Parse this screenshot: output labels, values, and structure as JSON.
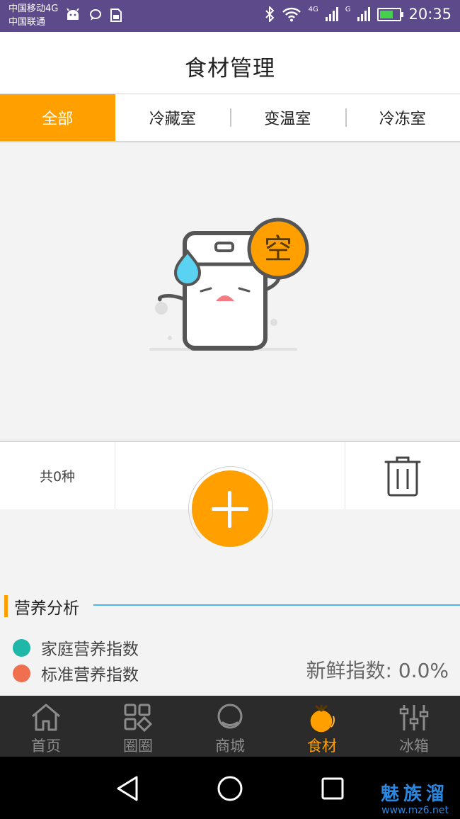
{
  "status_bar": {
    "carrier_1": "中国移动4G",
    "carrier_2": "中国联通",
    "net_1": "4G",
    "net_2": "G",
    "time": "20:35"
  },
  "header": {
    "title": "食材管理"
  },
  "tabs": [
    {
      "label": "全部",
      "active": true
    },
    {
      "label": "冷藏室",
      "active": false
    },
    {
      "label": "变温室",
      "active": false
    },
    {
      "label": "冷冻室",
      "active": false
    }
  ],
  "empty_state": {
    "badge": "空"
  },
  "actions": {
    "count_label": "共0种"
  },
  "nutrition": {
    "section_title": "营养分析",
    "legend": [
      {
        "label": "家庭营养指数",
        "color": "#1fb8a8"
      },
      {
        "label": "标准营养指数",
        "color": "#ef6f4f"
      }
    ],
    "freshness_label": "新鲜指数:",
    "freshness_value": "0.0%"
  },
  "bottom_nav": [
    {
      "label": "首页",
      "icon": "home-icon"
    },
    {
      "label": "圈圈",
      "icon": "grid-icon"
    },
    {
      "label": "商城",
      "icon": "chat-bubble-icon"
    },
    {
      "label": "食材",
      "icon": "orange-icon",
      "active": true
    },
    {
      "label": "冰箱",
      "icon": "sliders-icon"
    }
  ],
  "watermark": {
    "brand": "魅族溜",
    "site": "www.mz6.net"
  },
  "colors": {
    "accent": "#ffa000",
    "status_bar": "#5c4a8a",
    "nav_bg": "#2b2b2b"
  }
}
